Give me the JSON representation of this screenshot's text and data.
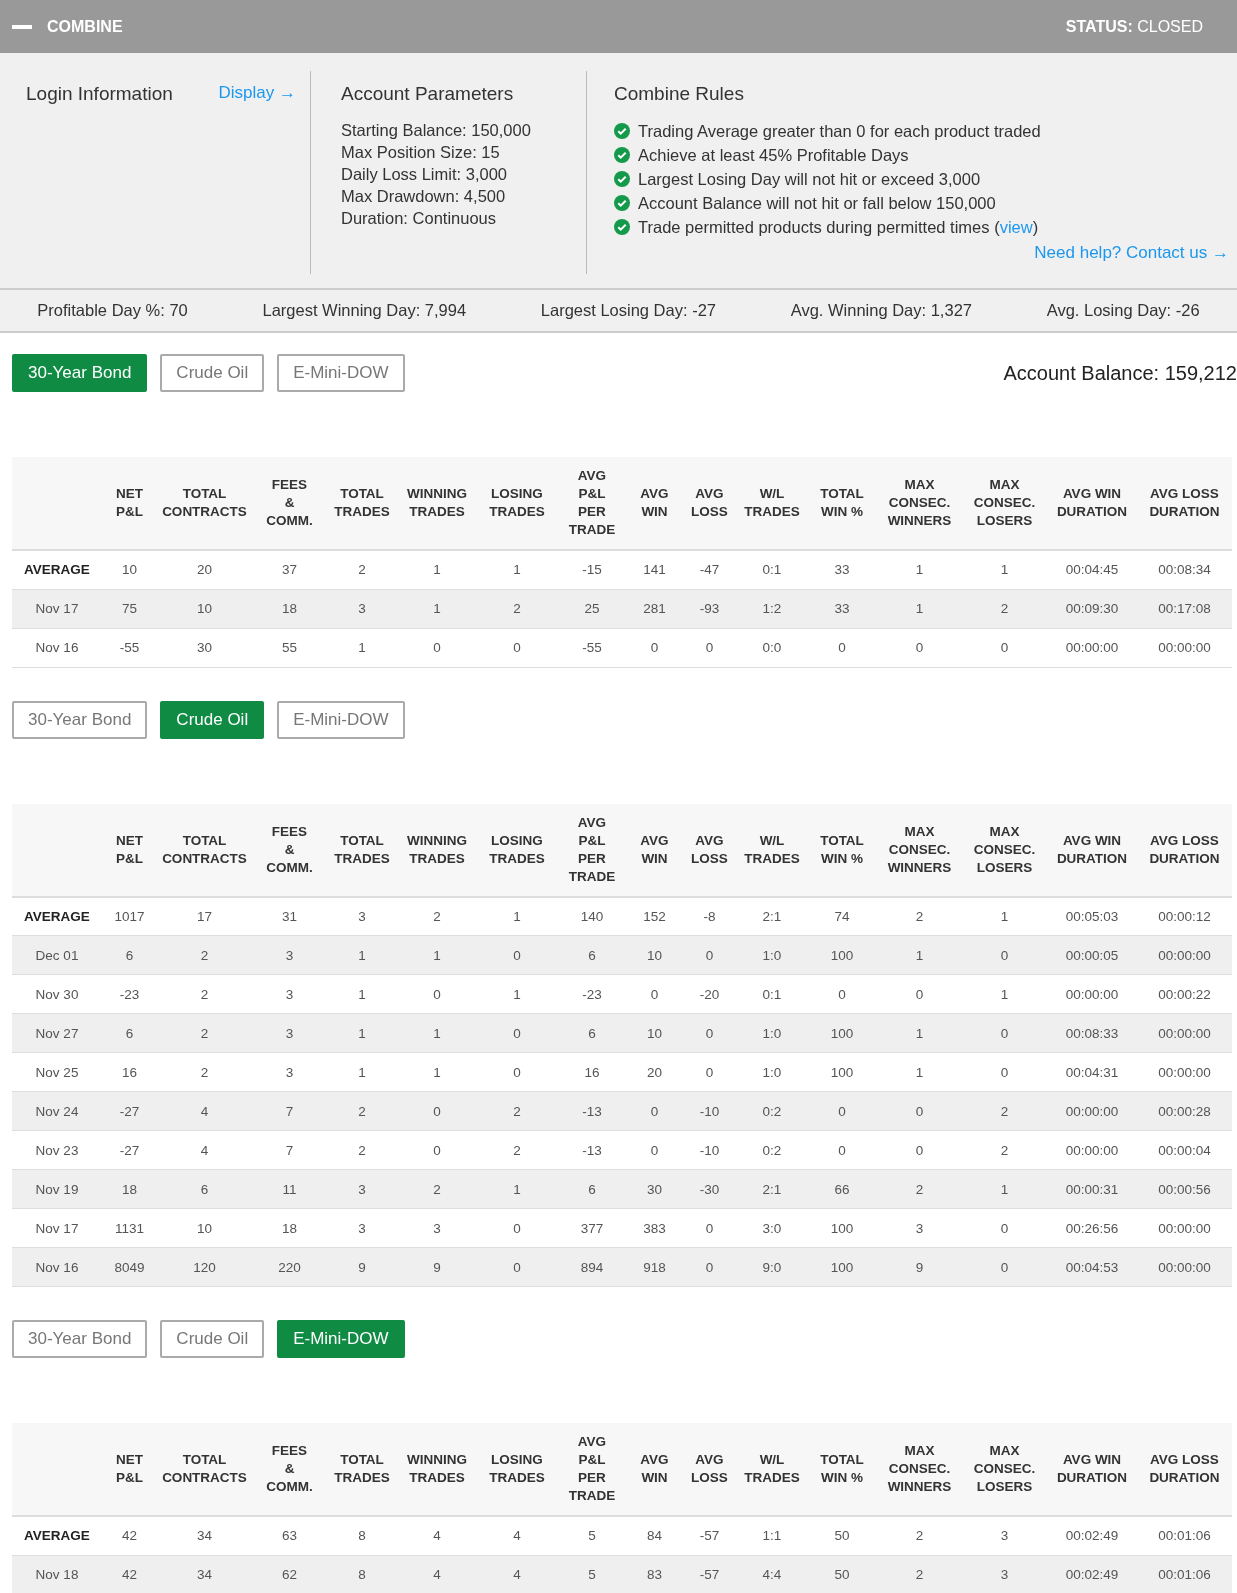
{
  "header": {
    "title": "COMBINE",
    "status": "**STATUS:** CLOSED"
  },
  "login": {
    "title": "Login Information",
    "link": "Display →"
  },
  "parameters": {
    "title": "Account Parameters",
    "items": [
      "Starting Balance: 150,000",
      "Max Position Size: 15",
      "Daily Loss Limit: 3,000",
      "Max Drawdown: 4,500",
      "Duration: Continuous"
    ]
  },
  "rules": {
    "title": "Combine Rules",
    "items": [
      {
        "text": "Trading Average greater than 0 for each product traded",
        "passed": true
      },
      {
        "text": "Achieve at least 45% Profitable Days",
        "passed": true
      },
      {
        "text": "Largest Losing Day will not hit or exceed 3,000",
        "passed": true
      },
      {
        "text": "Account Balance will not hit or fall below 150,000",
        "passed": true
      },
      {
        "text": "Trade permitted products during permitted times (",
        "link": "view",
        "after": ")",
        "passed": true
      }
    ],
    "help_link": "Need help? Contact us →"
  },
  "stats": [
    "Profitable Day %: 70",
    "Largest Winning Day: 7,994",
    "Largest Losing Day: -27",
    "Avg. Winning Day: 1,327",
    "Avg. Losing Day: -26"
  ],
  "sections": [
    {
      "tabs": [
        {
          "label": "30-Year Bond",
          "selected": true
        },
        {
          "label": "Crude Oil",
          "selected": false
        },
        {
          "label": "E-Mini-DOW",
          "selected": false
        }
      ],
      "account_balance": "Account Balance: 159,212",
      "columns": [
        "",
        "NET\nP&L",
        "TOTAL\nCONTRACTS",
        "FEES\n&\nCOMM.",
        "TOTAL\nTRADES",
        "WINNING\nTRADES",
        "LOSING\nTRADES",
        "AVG\nP&L\nPER\nTRADE",
        "AVG\nWIN",
        "AVG\nLOSS",
        "W/L\nTRADES",
        "TOTAL\nWIN %",
        "MAX\nCONSEC.\nWINNERS",
        "MAX\nCONSEC.\nLOSERS",
        "AVG WIN\nDURATION",
        "AVG LOSS\nDURATION"
      ],
      "rows": [
        {
          "kind": "average",
          "cells": [
            "AVERAGE",
            "10",
            "20",
            "37",
            "2",
            "1",
            "1",
            "-15",
            "141",
            "-47",
            "0:1",
            "33",
            "1",
            "1",
            "00:04:45",
            "00:08:34"
          ]
        },
        {
          "kind": "day",
          "cells": [
            "Nov 17",
            "75",
            "10",
            "18",
            "3",
            "1",
            "2",
            "25",
            "281",
            "-93",
            "1:2",
            "33",
            "1",
            "2",
            "00:09:30",
            "00:17:08"
          ]
        },
        {
          "kind": "day",
          "cells": [
            "Nov 16",
            "-55",
            "30",
            "55",
            "1",
            "0",
            "0",
            "-55",
            "0",
            "0",
            "0:0",
            "0",
            "0",
            "0",
            "00:00:00",
            "00:00:00"
          ]
        }
      ]
    },
    {
      "tabs": [
        {
          "label": "30-Year Bond",
          "selected": false
        },
        {
          "label": "Crude Oil",
          "selected": true
        },
        {
          "label": "E-Mini-DOW",
          "selected": false
        }
      ],
      "columns": [
        "",
        "NET\nP&L",
        "TOTAL\nCONTRACTS",
        "FEES\n&\nCOMM.",
        "TOTAL\nTRADES",
        "WINNING\nTRADES",
        "LOSING\nTRADES",
        "AVG\nP&L\nPER\nTRADE",
        "AVG\nWIN",
        "AVG\nLOSS",
        "W/L\nTRADES",
        "TOTAL\nWIN %",
        "MAX\nCONSEC.\nWINNERS",
        "MAX\nCONSEC.\nLOSERS",
        "AVG WIN\nDURATION",
        "AVG LOSS\nDURATION"
      ],
      "rows": [
        {
          "kind": "average",
          "cells": [
            "AVERAGE",
            "1017",
            "17",
            "31",
            "3",
            "2",
            "1",
            "140",
            "152",
            "-8",
            "2:1",
            "74",
            "2",
            "1",
            "00:05:03",
            "00:00:12"
          ]
        },
        {
          "kind": "day",
          "cells": [
            "Dec 01",
            "6",
            "2",
            "3",
            "1",
            "1",
            "0",
            "6",
            "10",
            "0",
            "1:0",
            "100",
            "1",
            "0",
            "00:00:05",
            "00:00:00"
          ]
        },
        {
          "kind": "day",
          "cells": [
            "Nov 30",
            "-23",
            "2",
            "3",
            "1",
            "0",
            "1",
            "-23",
            "0",
            "-20",
            "0:1",
            "0",
            "0",
            "1",
            "00:00:00",
            "00:00:22"
          ]
        },
        {
          "kind": "day",
          "cells": [
            "Nov 27",
            "6",
            "2",
            "3",
            "1",
            "1",
            "0",
            "6",
            "10",
            "0",
            "1:0",
            "100",
            "1",
            "0",
            "00:08:33",
            "00:00:00"
          ]
        },
        {
          "kind": "day",
          "cells": [
            "Nov 25",
            "16",
            "2",
            "3",
            "1",
            "1",
            "0",
            "16",
            "20",
            "0",
            "1:0",
            "100",
            "1",
            "0",
            "00:04:31",
            "00:00:00"
          ]
        },
        {
          "kind": "day",
          "cells": [
            "Nov 24",
            "-27",
            "4",
            "7",
            "2",
            "0",
            "2",
            "-13",
            "0",
            "-10",
            "0:2",
            "0",
            "0",
            "2",
            "00:00:00",
            "00:00:28"
          ]
        },
        {
          "kind": "day",
          "cells": [
            "Nov 23",
            "-27",
            "4",
            "7",
            "2",
            "0",
            "2",
            "-13",
            "0",
            "-10",
            "0:2",
            "0",
            "0",
            "2",
            "00:00:00",
            "00:00:04"
          ]
        },
        {
          "kind": "day",
          "cells": [
            "Nov 19",
            "18",
            "6",
            "11",
            "3",
            "2",
            "1",
            "6",
            "30",
            "-30",
            "2:1",
            "66",
            "2",
            "1",
            "00:00:31",
            "00:00:56"
          ]
        },
        {
          "kind": "day",
          "cells": [
            "Nov 17",
            "1131",
            "10",
            "18",
            "3",
            "3",
            "0",
            "377",
            "383",
            "0",
            "3:0",
            "100",
            "3",
            "0",
            "00:26:56",
            "00:00:00"
          ]
        },
        {
          "kind": "day",
          "cells": [
            "Nov 16",
            "8049",
            "120",
            "220",
            "9",
            "9",
            "0",
            "894",
            "918",
            "0",
            "9:0",
            "100",
            "9",
            "0",
            "00:04:53",
            "00:00:00"
          ]
        }
      ]
    },
    {
      "tabs": [
        {
          "label": "30-Year Bond",
          "selected": false
        },
        {
          "label": "Crude Oil",
          "selected": false
        },
        {
          "label": "E-Mini-DOW",
          "selected": true
        }
      ],
      "columns": [
        "",
        "NET\nP&L",
        "TOTAL\nCONTRACTS",
        "FEES\n&\nCOMM.",
        "TOTAL\nTRADES",
        "WINNING\nTRADES",
        "LOSING\nTRADES",
        "AVG\nP&L\nPER\nTRADE",
        "AVG\nWIN",
        "AVG\nLOSS",
        "W/L\nTRADES",
        "TOTAL\nWIN %",
        "MAX\nCONSEC.\nWINNERS",
        "MAX\nCONSEC.\nLOSERS",
        "AVG WIN\nDURATION",
        "AVG LOSS\nDURATION"
      ],
      "rows": [
        {
          "kind": "average",
          "cells": [
            "AVERAGE",
            "42",
            "34",
            "63",
            "8",
            "4",
            "4",
            "5",
            "84",
            "-57",
            "1:1",
            "50",
            "2",
            "3",
            "00:02:49",
            "00:01:06"
          ]
        },
        {
          "kind": "day",
          "cells": [
            "Nov 18",
            "42",
            "34",
            "62",
            "8",
            "4",
            "4",
            "5",
            "83",
            "-57",
            "4:4",
            "50",
            "2",
            "3",
            "00:02:49",
            "00:01:06"
          ]
        }
      ]
    }
  ]
}
